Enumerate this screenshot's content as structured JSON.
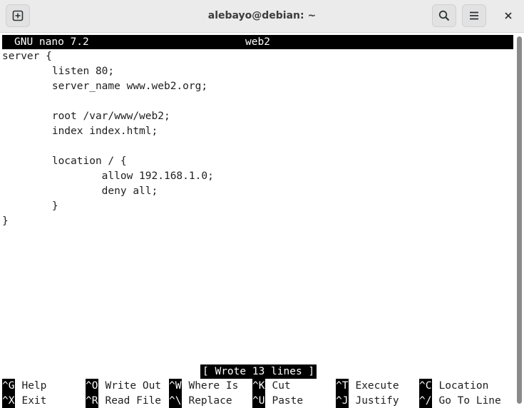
{
  "window": {
    "title": "alebayo@debian: ~",
    "icons": {
      "new_tab": "new-tab-plus-icon",
      "search": "search-icon",
      "menu": "hamburger-menu-icon",
      "close": "close-icon"
    }
  },
  "nano": {
    "version_label": "GNU nano 7.2",
    "filename": "web2",
    "status_message": "[ Wrote 13 lines ]",
    "file_lines": [
      "server {",
      "        listen 80;",
      "        server_name www.web2.org;",
      "",
      "        root /var/www/web2;",
      "        index index.html;",
      "",
      "        location / {",
      "                allow 192.168.1.0;",
      "                deny all;",
      "        }",
      "}"
    ],
    "shortcuts": [
      {
        "key": "^G",
        "label": "Help"
      },
      {
        "key": "^O",
        "label": "Write Out"
      },
      {
        "key": "^W",
        "label": "Where Is"
      },
      {
        "key": "^K",
        "label": "Cut"
      },
      {
        "key": "^T",
        "label": "Execute"
      },
      {
        "key": "^C",
        "label": "Location"
      },
      {
        "key": "^X",
        "label": "Exit"
      },
      {
        "key": "^R",
        "label": "Read File"
      },
      {
        "key": "^\\",
        "label": "Replace"
      },
      {
        "key": "^U",
        "label": "Paste"
      },
      {
        "key": "^J",
        "label": "Justify"
      },
      {
        "key": "^/",
        "label": "Go To Line"
      }
    ]
  },
  "colors": {
    "headerbar_bg": "#ebebeb",
    "terminal_bg": "#ffffff",
    "terminal_fg": "#1e1e1e",
    "inverse_bg": "#000000",
    "inverse_fg": "#ffffff"
  }
}
